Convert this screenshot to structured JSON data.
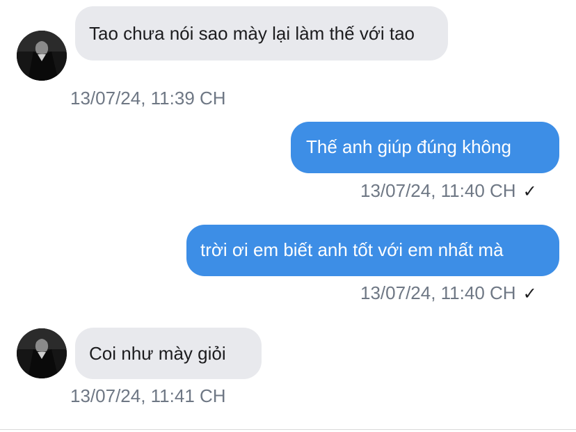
{
  "messages": [
    {
      "direction": "incoming",
      "text": "Tao chưa nói sao mày lại làm thế với tao",
      "timestamp": "13/07/24, 11:39 CH"
    },
    {
      "direction": "outgoing",
      "text": "Thế anh giúp đúng không",
      "timestamp": "13/07/24, 11:40 CH",
      "status_icon": "✓"
    },
    {
      "direction": "outgoing",
      "text": "trời ơi em biết anh tốt với em nhất mà",
      "timestamp": "13/07/24, 11:40 CH",
      "status_icon": "✓"
    },
    {
      "direction": "incoming",
      "text": "Coi như mày giỏi",
      "timestamp": "13/07/24, 11:41 CH"
    }
  ],
  "colors": {
    "incoming_bubble": "#e8e9ed",
    "outgoing_bubble": "#3d8ee6",
    "timestamp": "#6e7784"
  },
  "icons": {
    "read_receipt": "check-icon",
    "avatar": "contact-avatar"
  }
}
